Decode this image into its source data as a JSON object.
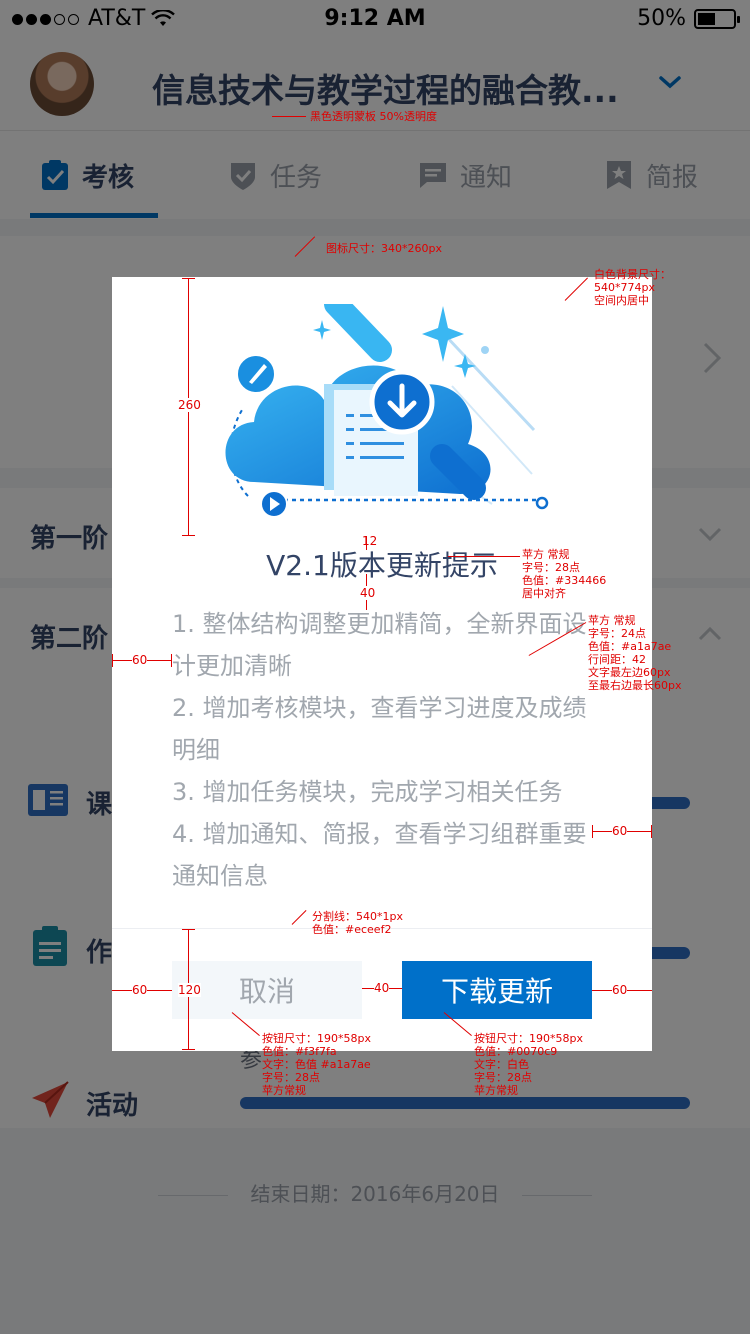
{
  "status_bar": {
    "carrier": "AT&T",
    "time": "9:12 AM",
    "battery": "50%",
    "battery_level": 0.5
  },
  "header": {
    "title": "信息技术与教学过程的融合教..."
  },
  "tabs": [
    {
      "label": "考核",
      "icon": "clipboard-check-icon",
      "active": true
    },
    {
      "label": "任务",
      "icon": "shield-check-icon",
      "active": false
    },
    {
      "label": "通知",
      "icon": "message-icon",
      "active": false
    },
    {
      "label": "简报",
      "icon": "bookmark-star-icon",
      "active": false
    }
  ],
  "background": {
    "phase1": "第一阶",
    "phase2": "第二阶",
    "items": [
      {
        "label": "课",
        "icon": "book-icon"
      },
      {
        "label": "作",
        "icon": "clipboard-icon"
      },
      {
        "label": "活动",
        "icon": "paper-plane-icon"
      }
    ],
    "participate_text": "参",
    "end_date": "结束日期：2016年6月20日"
  },
  "modal": {
    "title": "V2.1版本更新提示",
    "body": [
      "1. 整体结构调整更加精简，全新界面设计更加清晰",
      "2. 增加考核模块，查看学习进度及成绩明细",
      "3. 增加任务模块，完成学习相关任务",
      "4. 增加通知、简报，查看学习组群重要通知信息"
    ],
    "cancel_label": "取消",
    "download_label": "下载更新"
  },
  "annotations": {
    "mask": "黑色透明蒙板  50%透明度",
    "icon_size": "图标尺寸：340*260px",
    "bg_size_1": "白色背景尺寸：",
    "bg_size_2": "540*774px",
    "bg_size_3": "空间内居中",
    "title_font_1": "苹方 常规",
    "title_font_2": "字号：28点",
    "title_font_3": "色值：#334466",
    "title_font_4": "居中对齐",
    "body_font_1": "苹方 常规",
    "body_font_2": "字号：24点",
    "body_font_3": "色值：#a1a7ae",
    "body_font_4": "行间距：42",
    "body_font_5": "文字最左边60px",
    "body_font_6": "至最右边最长60px",
    "divider_1": "分割线：540*1px",
    "divider_2": "色值：#eceef2",
    "cancel_spec_1": "按钮尺寸：190*58px",
    "cancel_spec_2": "色值：#f3f7fa",
    "cancel_spec_3": "文字：色值 #a1a7ae",
    "cancel_spec_4": "字号：28点",
    "cancel_spec_5": "苹方常规",
    "dl_spec_1": "按钮尺寸：190*58px",
    "dl_spec_2": "色值：#0070c9",
    "dl_spec_3": "文字：白色",
    "dl_spec_4": "字号：28点",
    "dl_spec_5": "苹方常规",
    "dim_260": "260",
    "dim_12": "12",
    "dim_40_v": "40",
    "dim_60_a": "60",
    "dim_60_b": "60",
    "dim_120": "120",
    "dim_60_c": "60",
    "dim_40_h": "40",
    "dim_60_d": "60"
  },
  "colors": {
    "accent": "#0070c9",
    "title": "#334466",
    "body": "#a1a7ae",
    "cancel_bg": "#f3f7fa",
    "divider": "#eceef2"
  }
}
